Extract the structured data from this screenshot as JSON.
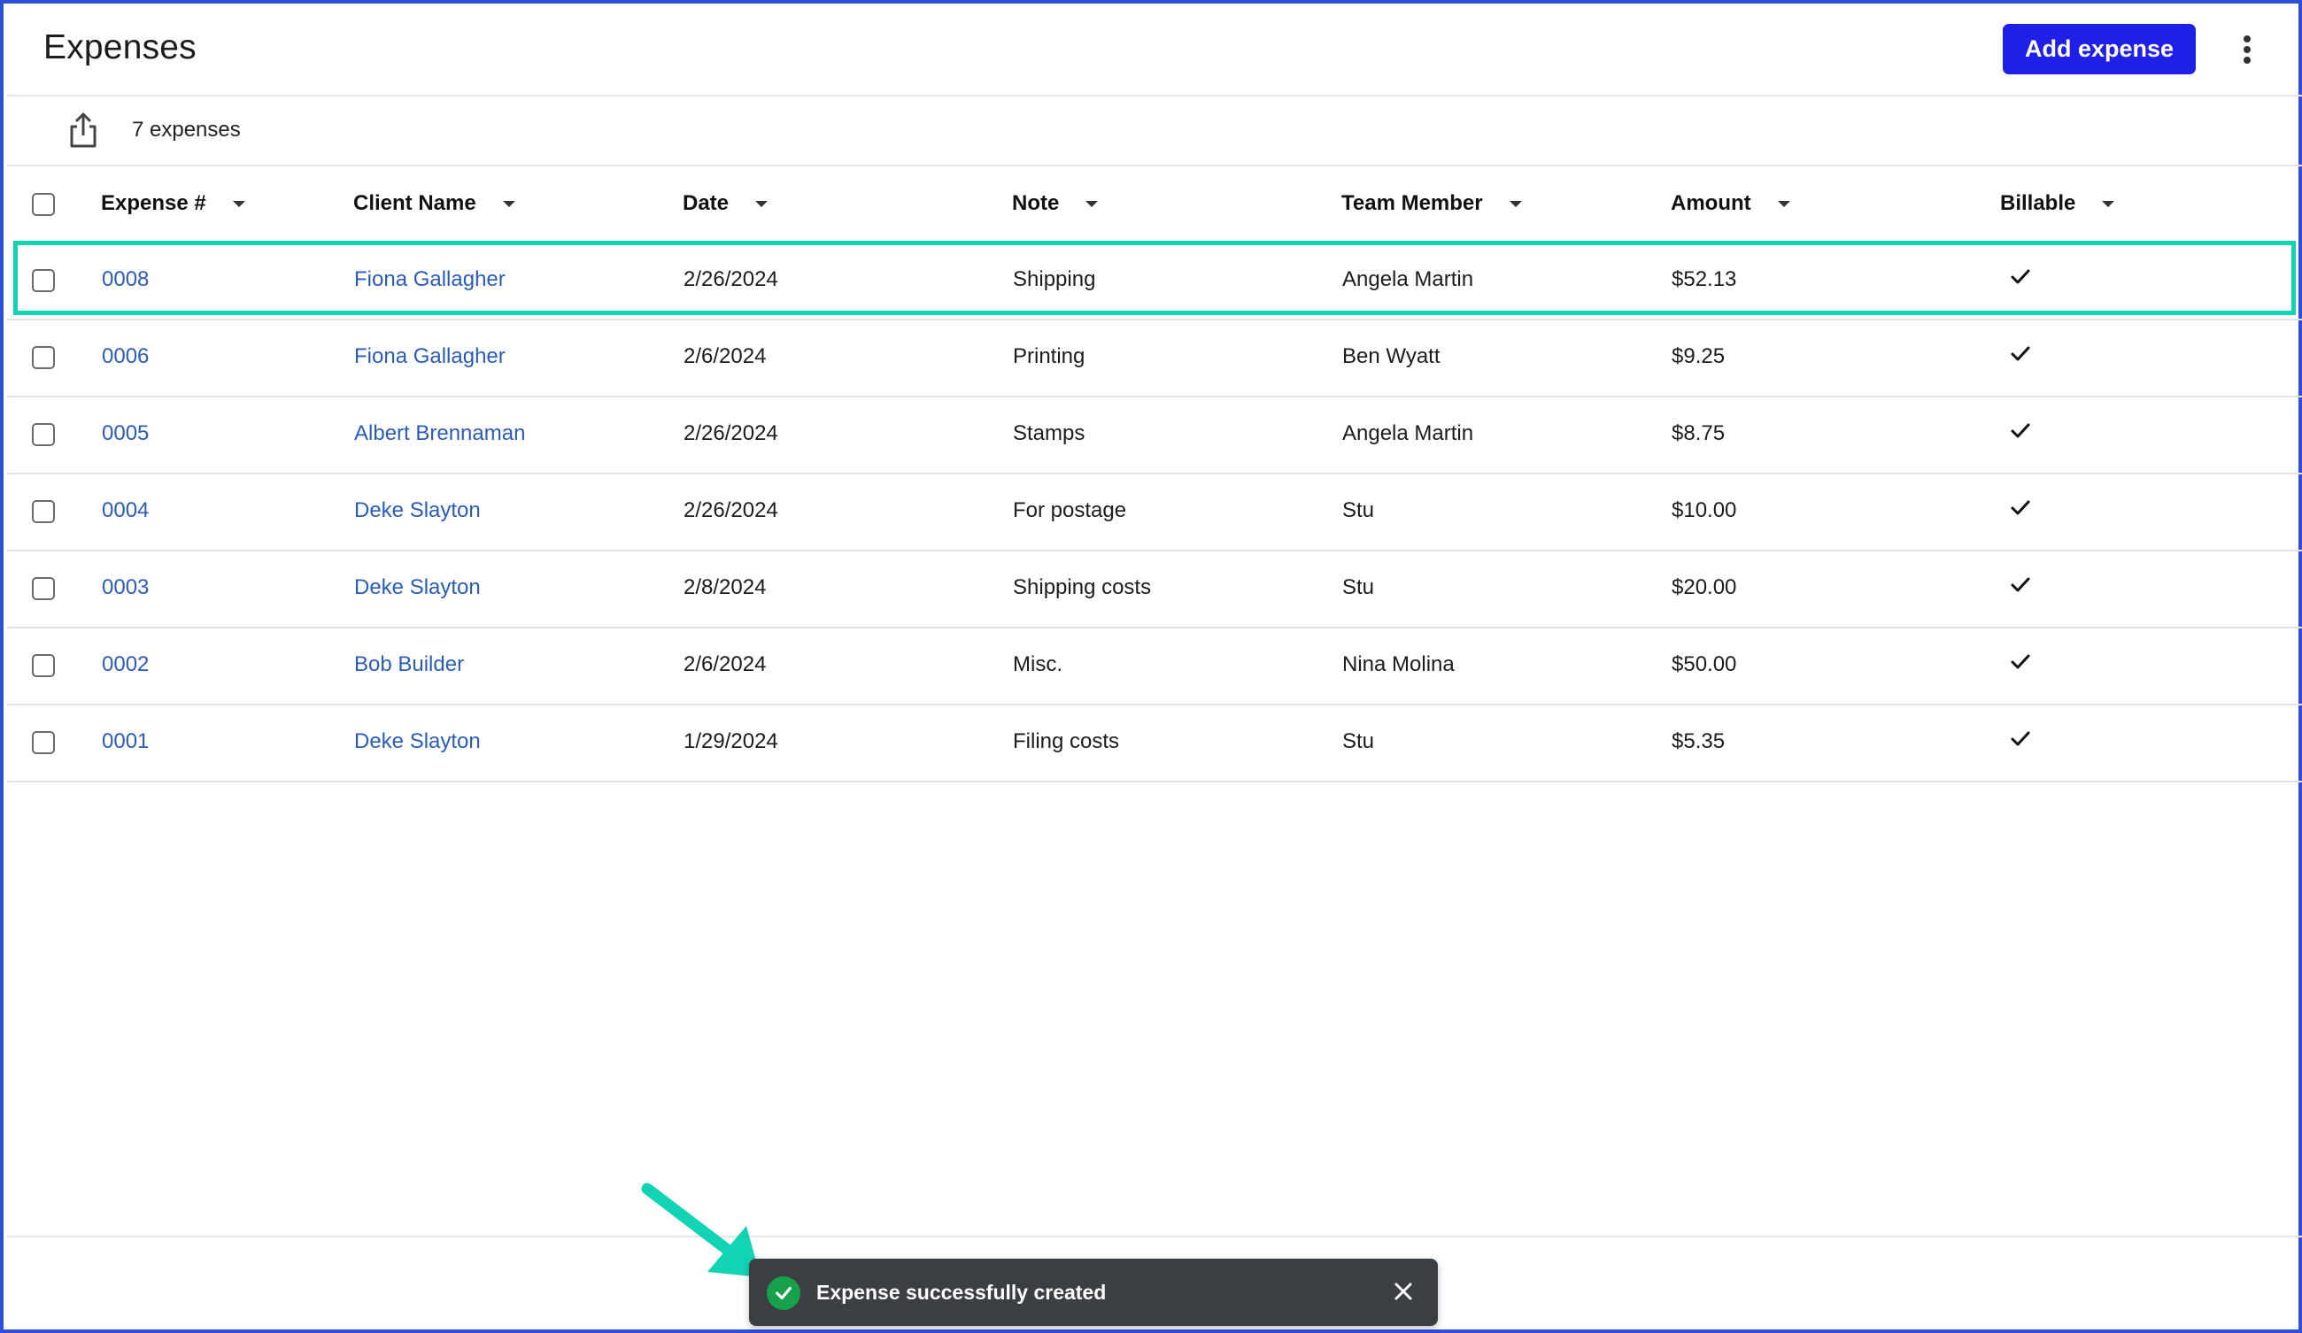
{
  "header": {
    "title": "Expenses",
    "add_button_label": "Add expense"
  },
  "toolbar": {
    "count_label": "7 expenses"
  },
  "table": {
    "columns": [
      "Expense #",
      "Client Name",
      "Date",
      "Note",
      "Team Member",
      "Amount",
      "Billable"
    ],
    "rows": [
      {
        "expense": "0008",
        "client": "Fiona Gallagher",
        "date": "2/26/2024",
        "note": "Shipping",
        "member": "Angela Martin",
        "amount": "$52.13",
        "billable": true
      },
      {
        "expense": "0006",
        "client": "Fiona Gallagher",
        "date": "2/6/2024",
        "note": "Printing",
        "member": "Ben Wyatt",
        "amount": "$9.25",
        "billable": true
      },
      {
        "expense": "0005",
        "client": "Albert Brennaman",
        "date": "2/26/2024",
        "note": "Stamps",
        "member": "Angela Martin",
        "amount": "$8.75",
        "billable": true
      },
      {
        "expense": "0004",
        "client": "Deke Slayton",
        "date": "2/26/2024",
        "note": "For postage",
        "member": "Stu",
        "amount": "$10.00",
        "billable": true
      },
      {
        "expense": "0003",
        "client": "Deke Slayton",
        "date": "2/8/2024",
        "note": "Shipping costs",
        "member": "Stu",
        "amount": "$20.00",
        "billable": true
      },
      {
        "expense": "0002",
        "client": "Bob Builder",
        "date": "2/6/2024",
        "note": "Misc.",
        "member": "Nina Molina",
        "amount": "$50.00",
        "billable": true
      },
      {
        "expense": "0001",
        "client": "Deke Slayton",
        "date": "1/29/2024",
        "note": "Filing costs",
        "member": "Stu",
        "amount": "$5.35",
        "billable": true
      }
    ]
  },
  "toast": {
    "message": "Expense successfully created"
  },
  "colors": {
    "accent": "#1f1fe6",
    "link": "#2a5cb8",
    "highlight": "#13d3b5",
    "toast_bg": "#3b3f44",
    "success": "#17a14a"
  },
  "icons": [
    "export-icon",
    "kebab-menu-icon",
    "sort-caret-icon",
    "check-icon",
    "success-icon",
    "close-icon"
  ]
}
